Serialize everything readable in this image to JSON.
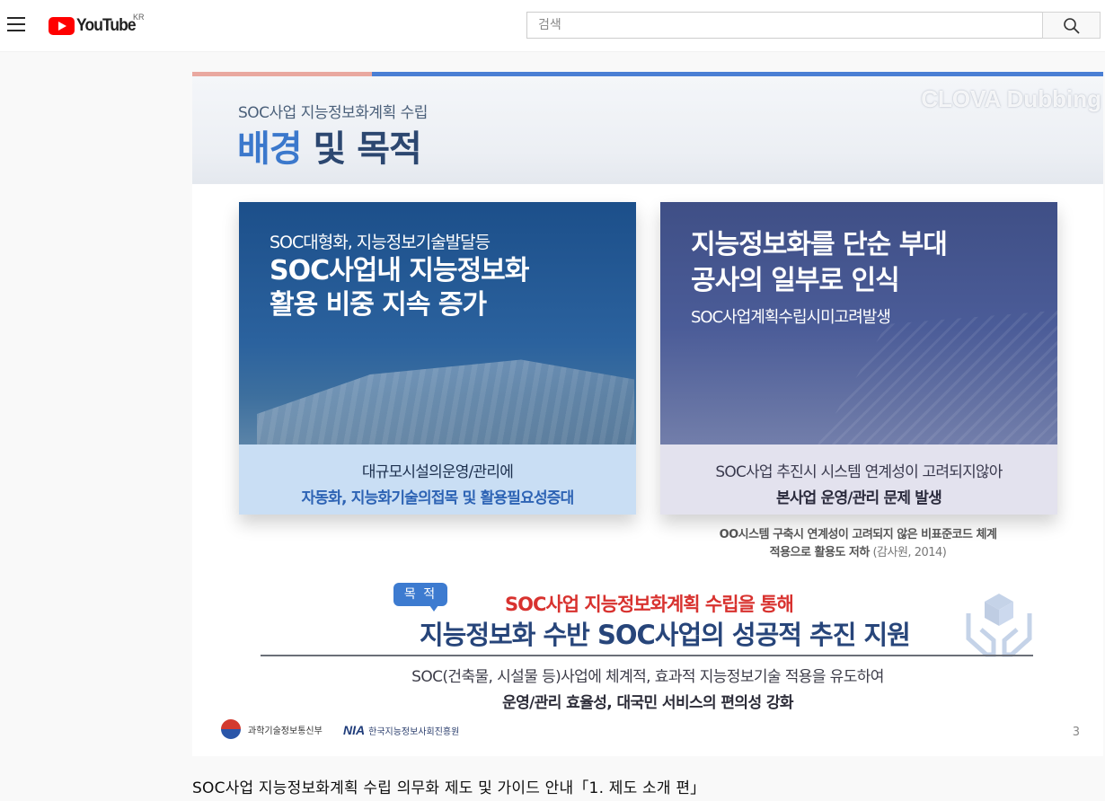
{
  "header": {
    "menu_icon": "hamburger-menu-icon",
    "logo_text": "YouTube",
    "region": "KR",
    "search": {
      "placeholder": "검색",
      "value": ""
    },
    "search_icon": "search-icon"
  },
  "video": {
    "watermark": "CLOVA Dubbing",
    "slide": {
      "subtitle": "SOC사업 지능정보화계획 수립",
      "title_part1": "배경",
      "title_part2": " 및 목적",
      "left_card": {
        "line1": "SOC대형화, 지능정보기술발달등",
        "line2": "SOC사업내 지능정보화",
        "line3": "활용 비중 지속 증가",
        "foot1": "대규모시설의운영/관리에",
        "foot2": "자동화, 지능화기술의접목 및 활용필요성증대"
      },
      "right_card": {
        "line1": "지능정보화를 단순 부대",
        "line2": "공사의 일부로 인식",
        "line3": "SOC사업계획수립시미고려발생",
        "foot1": "SOC사업 추진시 시스템 연계성이 고려되지않아",
        "foot2": "본사업 운영/관리 문제 발생"
      },
      "note_line1": "OO시스템 구축시 연계성이 고려되지 않은 비표준코드 체계",
      "note_line2a": "적용으로 활용도 저하",
      "note_line2b": "(감사원, 2014)",
      "purpose_badge": "목 적",
      "goal_red": "SOC사업 지능정보화계획 수립을 통해",
      "goal_main": "지능정보화 수반 SOC사업의 성공적 추진 지원",
      "goal_desc1": "SOC(건축물, 시설물 등)사업에 체계적, 효과적 지능정보기술 적용을 유도하여",
      "goal_desc2": "운영/관리 효율성, 대국민 서비스의 편의성 강화",
      "gov_name": "과학기술정보통신부",
      "nia_abbr": "NIA",
      "nia_name": "한국지능정보사회진흥원",
      "page_number": "3"
    }
  },
  "video_title": "SOC사업 지능정보화계획 수립 의무화 제도 및 가이드 안내「1. 제도 소개 편」",
  "colors": {
    "youtube_red": "#ff0000",
    "slide_blue": "#3b78cc",
    "slide_navy": "#27457a",
    "goal_red": "#d8322f"
  }
}
